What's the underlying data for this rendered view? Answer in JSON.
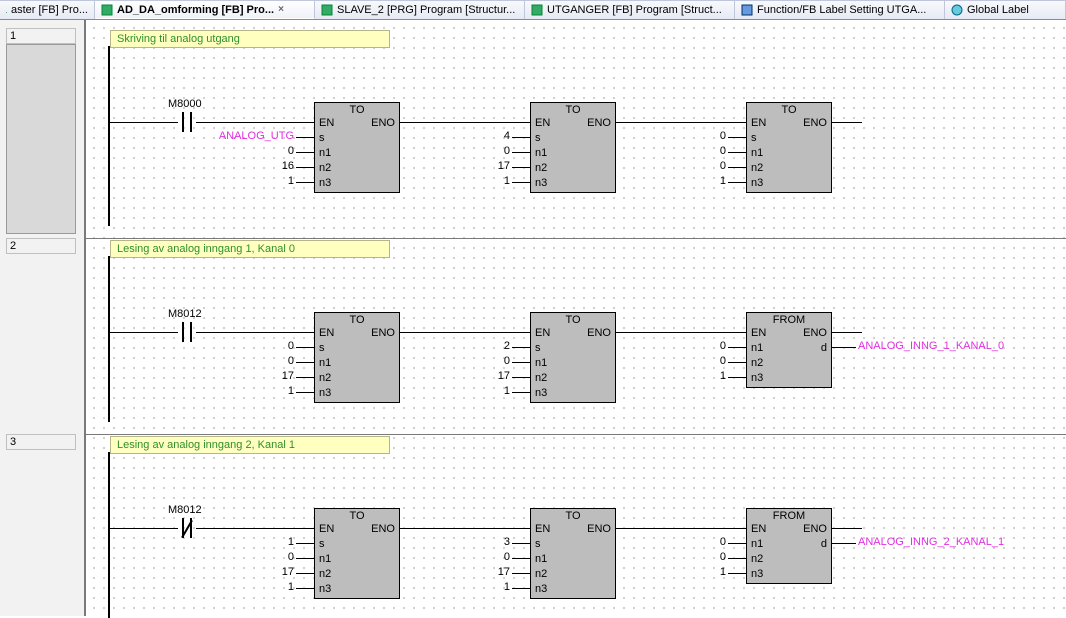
{
  "tabs": [
    {
      "label": "aster [FB] Pro...",
      "active": false
    },
    {
      "label": "AD_DA_omforming [FB] Pro...",
      "active": true,
      "closable": true
    },
    {
      "label": "SLAVE_2 [PRG] Program [Structur...",
      "active": false
    },
    {
      "label": "UTGANGER [FB] Program [Struct...",
      "active": false
    },
    {
      "label": "Function/FB Label Setting UTGA...",
      "active": false
    },
    {
      "label": "Global Label",
      "active": false
    }
  ],
  "rung_numbers": {
    "r1": "1",
    "r2": "2",
    "r3": "3"
  },
  "rungs": [
    {
      "label": "Skriving til analog utgang",
      "contact": "M8000",
      "contact_type": "no",
      "blocks": [
        {
          "title": "TO",
          "ports_in": [
            "EN",
            "s",
            "n1",
            "n2",
            "n3"
          ],
          "ports_out": [
            "ENO"
          ],
          "in_vals": [
            "",
            "ANALOG_UTG",
            "0",
            "16",
            "1"
          ],
          "in_color_idx": 1
        },
        {
          "title": "TO",
          "ports_in": [
            "EN",
            "s",
            "n1",
            "n2",
            "n3"
          ],
          "ports_out": [
            "ENO"
          ],
          "in_vals": [
            "",
            "4",
            "0",
            "17",
            "1"
          ]
        },
        {
          "title": "TO",
          "ports_in": [
            "EN",
            "s",
            "n1",
            "n2",
            "n3"
          ],
          "ports_out": [
            "ENO"
          ],
          "in_vals": [
            "",
            "0",
            "0",
            "0",
            "1"
          ]
        }
      ],
      "output": ""
    },
    {
      "label": "Lesing av analog inngang 1, Kanal 0",
      "contact": "M8012",
      "contact_type": "no",
      "blocks": [
        {
          "title": "TO",
          "ports_in": [
            "EN",
            "s",
            "n1",
            "n2",
            "n3"
          ],
          "ports_out": [
            "ENO"
          ],
          "in_vals": [
            "",
            "0",
            "0",
            "17",
            "1"
          ]
        },
        {
          "title": "TO",
          "ports_in": [
            "EN",
            "s",
            "n1",
            "n2",
            "n3"
          ],
          "ports_out": [
            "ENO"
          ],
          "in_vals": [
            "",
            "2",
            "0",
            "17",
            "1"
          ]
        },
        {
          "title": "FROM",
          "ports_in": [
            "EN",
            "n1",
            "n2",
            "n3"
          ],
          "ports_out": [
            "ENO",
            "d"
          ],
          "in_vals": [
            "",
            "0",
            "0",
            "1"
          ]
        }
      ],
      "output": "ANALOG_INNG_1_KANAL_0"
    },
    {
      "label": "Lesing av analog inngang 2, Kanal 1",
      "contact": "M8012",
      "contact_type": "nc",
      "blocks": [
        {
          "title": "TO",
          "ports_in": [
            "EN",
            "s",
            "n1",
            "n2",
            "n3"
          ],
          "ports_out": [
            "ENO"
          ],
          "in_vals": [
            "",
            "1",
            "0",
            "17",
            "1"
          ]
        },
        {
          "title": "TO",
          "ports_in": [
            "EN",
            "s",
            "n1",
            "n2",
            "n3"
          ],
          "ports_out": [
            "ENO"
          ],
          "in_vals": [
            "",
            "3",
            "0",
            "17",
            "1"
          ]
        },
        {
          "title": "FROM",
          "ports_in": [
            "EN",
            "n1",
            "n2",
            "n3"
          ],
          "ports_out": [
            "ENO",
            "d"
          ],
          "in_vals": [
            "",
            "0",
            "0",
            "1"
          ]
        }
      ],
      "output": "ANALOG_INNG_2_KANAL_1"
    }
  ]
}
